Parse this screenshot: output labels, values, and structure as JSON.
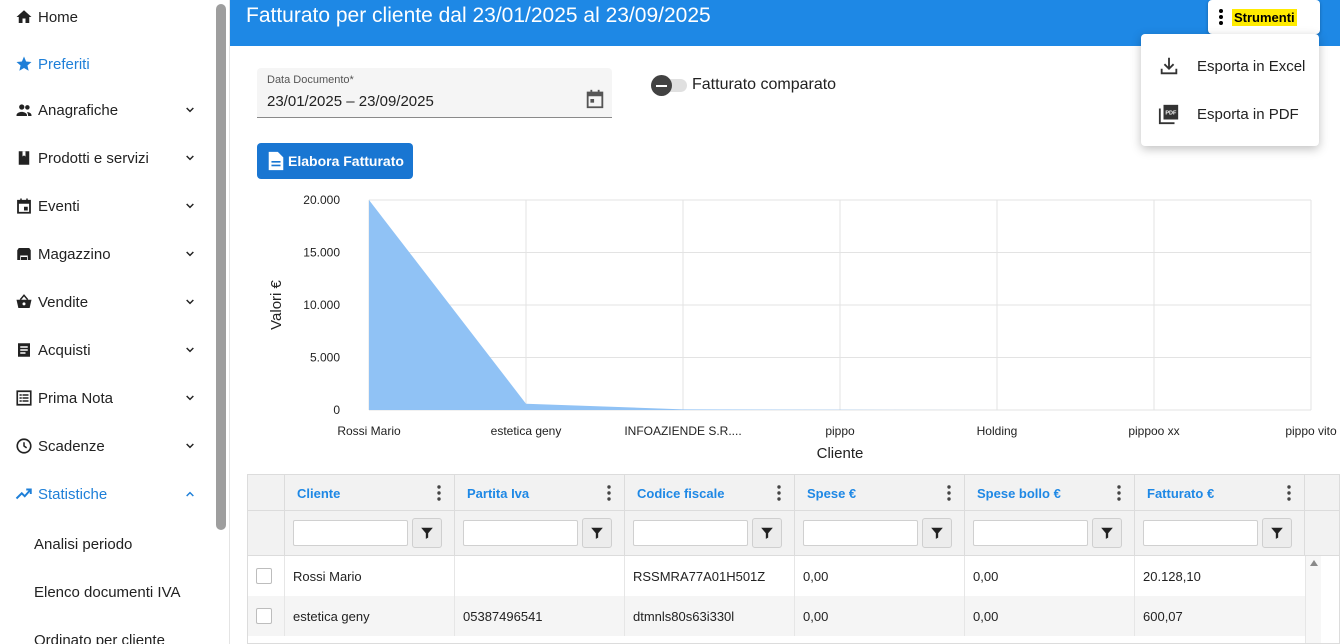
{
  "sidebar": {
    "items": [
      {
        "label": "Home",
        "icon": "home-icon"
      },
      {
        "label": "Preferiti",
        "icon": "star-icon"
      },
      {
        "label": "Anagrafiche",
        "icon": "people-icon"
      },
      {
        "label": "Prodotti e servizi",
        "icon": "book-icon"
      },
      {
        "label": "Eventi",
        "icon": "calendar-icon"
      },
      {
        "label": "Magazzino",
        "icon": "warehouse-icon"
      },
      {
        "label": "Vendite",
        "icon": "basket-icon"
      },
      {
        "label": "Acquisti",
        "icon": "receipt-icon"
      },
      {
        "label": "Prima Nota",
        "icon": "list-icon"
      },
      {
        "label": "Scadenze",
        "icon": "clock-icon"
      },
      {
        "label": "Statistiche",
        "icon": "trending-up-icon"
      }
    ],
    "subitems": [
      "Analisi periodo",
      "Elenco documenti IVA",
      "Ordinato per cliente"
    ],
    "accent": "#1e7fd8"
  },
  "header": {
    "title": "Fatturato per cliente dal 23/01/2025 al 23/09/2025",
    "tools_label": "Strumenti",
    "bg": "#1e88e5"
  },
  "menu": {
    "items": [
      {
        "label": "Esporta in Excel",
        "icon": "download-icon"
      },
      {
        "label": "Esporta in PDF",
        "icon": "pdf-icon"
      }
    ]
  },
  "filters": {
    "date_label": "Data Documento*",
    "date_value": "23/01/2025 – 23/09/2025",
    "toggle_label": "Fatturato comparato",
    "elabora_label": "Elabora Fatturato"
  },
  "chart_data": {
    "type": "area",
    "categories": [
      "Rossi Mario",
      "estetica geny",
      "INFOAZIENDE S.R....",
      "pippo",
      "Holding",
      "pippoo xx",
      "pippo vito"
    ],
    "values": [
      20128.1,
      600.07,
      60,
      20,
      0,
      0,
      0
    ],
    "xlabel": "Cliente",
    "ylabel": "Valori €",
    "ylim": [
      0,
      20000
    ],
    "yticks": [
      "0",
      "5.000",
      "10.000",
      "15.000",
      "20.000"
    ],
    "grid": true,
    "fill": "#90c2f5"
  },
  "table": {
    "columns": [
      "Cliente",
      "Partita Iva",
      "Codice fiscale",
      "Spese €",
      "Spese bollo €",
      "Fatturato €"
    ],
    "rows": [
      [
        "Rossi Mario",
        "",
        "RSSMRA77A01H501Z",
        "0,00",
        "0,00",
        "20.128,10"
      ],
      [
        "estetica geny",
        "05387496541",
        "dtmnls80s63i330l",
        "0,00",
        "0,00",
        "600,07"
      ]
    ]
  }
}
